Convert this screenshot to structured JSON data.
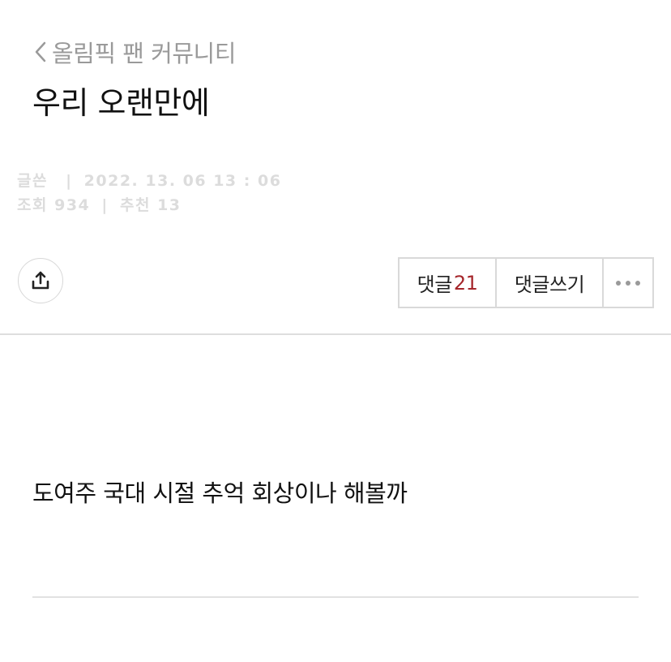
{
  "header": {
    "breadcrumb_label": "올림픽 팬 커뮤니티",
    "title": "우리 오랜만에"
  },
  "meta": {
    "author_label": "글쓴",
    "separator": "|",
    "datetime": "2022. 13. 06 13 : 06",
    "views_label": "조회",
    "views": "934",
    "likes_label": "추천",
    "likes": "13"
  },
  "actions": {
    "comments_label": "댓글",
    "comments_count": "21",
    "write_comment_label": "댓글쓰기"
  },
  "post": {
    "body": "도여주 국대 시절 추억 회상이나 해볼까"
  },
  "colors": {
    "accent": "#a5262b",
    "muted": "#9a9a9a",
    "meta": "#dcdcdc",
    "divider": "#dedede"
  },
  "icons": {
    "back": "chevron-left-icon",
    "share": "share-upload-icon",
    "more": "more-dots-icon"
  }
}
